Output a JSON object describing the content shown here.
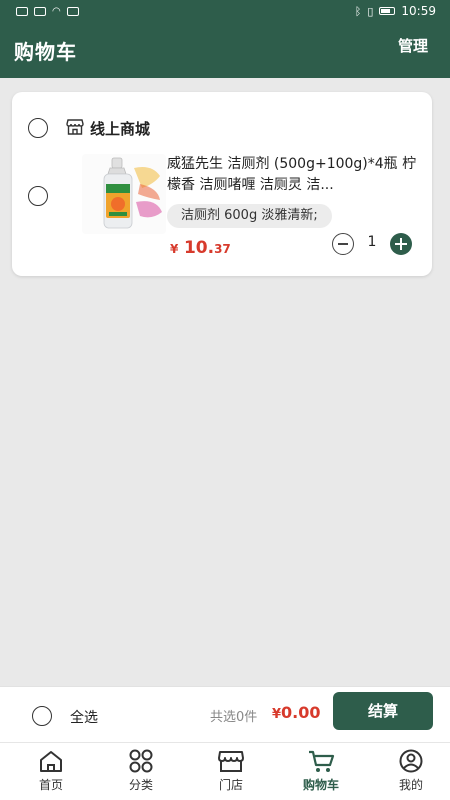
{
  "status_bar": {
    "time": "10:59"
  },
  "header": {
    "title": "购物车",
    "manage_label": "管理"
  },
  "cart": {
    "store_name": "线上商城",
    "item": {
      "title": "威猛先生 洁厕剂 (500g+100g)*4瓶 柠檬香 洁厕啫喱 洁厕灵 洁...",
      "spec": "洁厕剂 600g 淡雅清新;",
      "price_currency": "¥",
      "price_int": "10.",
      "price_dec": "37",
      "quantity": "1"
    }
  },
  "checkout": {
    "select_all_label": "全选",
    "selected_count": "共选0件",
    "total_currency": "¥",
    "total_amount": "0.00",
    "button_label": "结算"
  },
  "tabs": [
    {
      "label": "首页",
      "icon": "home-icon"
    },
    {
      "label": "分类",
      "icon": "grid-icon"
    },
    {
      "label": "门店",
      "icon": "store-icon"
    },
    {
      "label": "购物车",
      "icon": "cart-icon",
      "active": true
    },
    {
      "label": "我的",
      "icon": "user-icon"
    }
  ],
  "colors": {
    "primary": "#2e5d4b",
    "price": "#d73a2c",
    "background": "#e9e9e9"
  }
}
